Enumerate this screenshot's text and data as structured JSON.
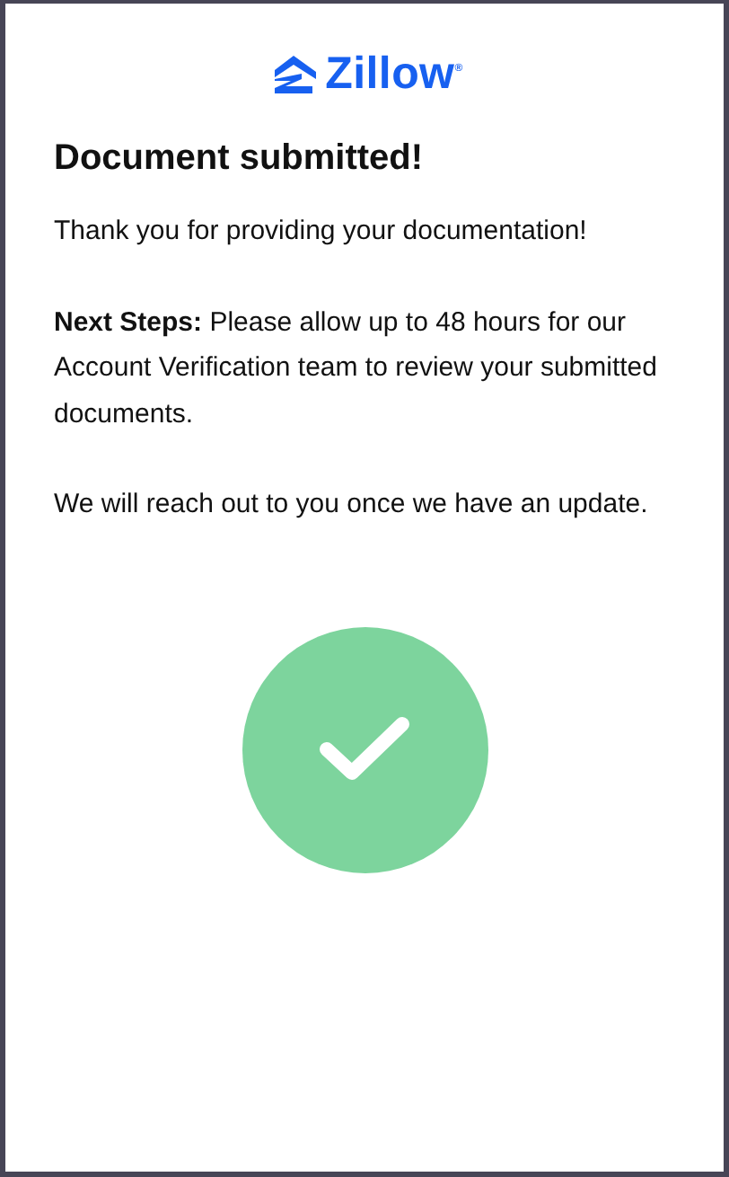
{
  "logo": {
    "text": "Zillow$^{®}$"
  },
  "title": "Document submitted!",
  "paragraphs": [
    "Thank you for providing your documentation!",
    "**Next Steps:** Please allow up to 48 hours for our Account Verification team to review your submitted documents.",
    "We will reach out to you once we have an update."
  ],
  "status": {
    "kind": "success"
  }
}
